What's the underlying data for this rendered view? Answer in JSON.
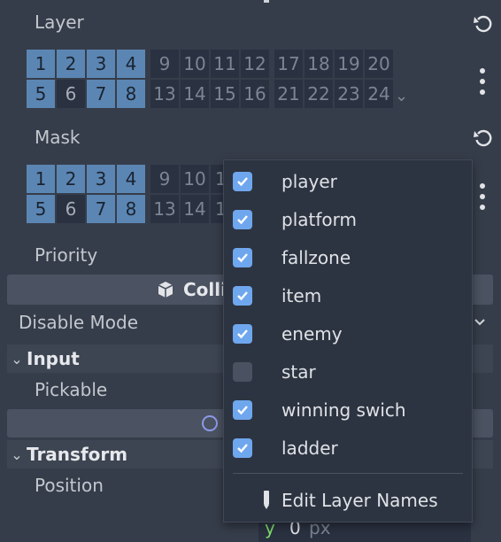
{
  "layer": {
    "label": "Layer",
    "bits": [
      [
        "1",
        "2",
        "3",
        "4"
      ],
      [
        "9",
        "10",
        "11",
        "12"
      ],
      [
        "17",
        "18",
        "19",
        "20"
      ],
      [
        "5",
        "6",
        "7",
        "8"
      ],
      [
        "13",
        "14",
        "15",
        "16"
      ],
      [
        "21",
        "22",
        "23",
        "24"
      ]
    ],
    "expand_glyph": "⌄"
  },
  "mask": {
    "label": "Mask",
    "bits_visible": [
      "1",
      "2",
      "3",
      "4",
      "9",
      "10",
      "1",
      "5",
      "6",
      "7",
      "8",
      "13",
      "14",
      "1"
    ]
  },
  "priority": {
    "label": "Priority"
  },
  "collision_bar": {
    "label": "Colli"
  },
  "disable_mode": {
    "label": "Disable Mode"
  },
  "input_section": {
    "label": "Input",
    "pickable_label": "Pickable"
  },
  "transform_section": {
    "label": "Transform",
    "position_label": "Position"
  },
  "position_y": {
    "axis": "y",
    "value": "0",
    "unit": "px"
  },
  "popup": {
    "items": [
      {
        "label": "player",
        "checked": true
      },
      {
        "label": "platform",
        "checked": true
      },
      {
        "label": "fallzone",
        "checked": true
      },
      {
        "label": "item",
        "checked": true
      },
      {
        "label": "enemy",
        "checked": true
      },
      {
        "label": "star",
        "checked": false
      },
      {
        "label": "winning swich",
        "checked": true
      },
      {
        "label": "ladder",
        "checked": true
      }
    ],
    "edit_label": "Edit Layer Names"
  },
  "colors": {
    "panel_bg": "#363d4a",
    "bit_on": "#5b86b3",
    "bit_off": "#2a3140",
    "checkbox_on": "#6fa7ee",
    "checkbox_off": "#4a5160",
    "popup_bg": "#2d3441"
  },
  "icons": [
    "revert-icon",
    "kebab-menu-icon",
    "box-icon",
    "chevron-down-icon",
    "pencil-icon",
    "check-icon"
  ]
}
